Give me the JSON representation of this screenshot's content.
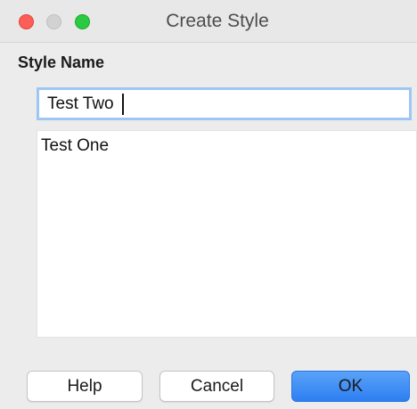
{
  "window": {
    "title": "Create Style"
  },
  "form": {
    "section_label": "Style Name",
    "name_value": "Test Two"
  },
  "style_list": {
    "items": [
      "Test One"
    ]
  },
  "buttons": {
    "help": "Help",
    "cancel": "Cancel",
    "ok": "OK"
  },
  "colors": {
    "accent": "#3a8af5",
    "close": "#fd5f57",
    "zoom": "#2acb42"
  }
}
